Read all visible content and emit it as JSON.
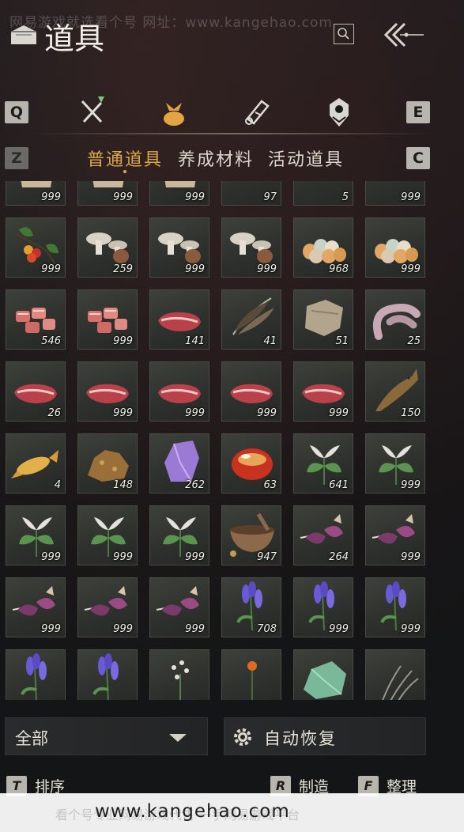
{
  "watermark_top": "网易游戏就选看个号   网址：www.kangehao.com",
  "header": {
    "title": "道具"
  },
  "category_tabs": {
    "prev_key": "Q",
    "next_key": "E",
    "tabs": [
      {
        "icon": "crossed-weapons-icon",
        "active": false
      },
      {
        "icon": "pouch-icon",
        "active": true
      },
      {
        "icon": "scroll-icon",
        "active": false
      },
      {
        "icon": "token-icon",
        "active": false
      }
    ]
  },
  "sub_tabs": {
    "prev_key": "Z",
    "next_key": "C",
    "tabs": [
      {
        "label": "普通道具",
        "active": true
      },
      {
        "label": "养成材料",
        "active": false
      },
      {
        "label": "活动道具",
        "active": false
      }
    ]
  },
  "items": [
    {
      "icon": "grain-sack-icon",
      "count": "999"
    },
    {
      "icon": "grain-sack-icon",
      "count": "999"
    },
    {
      "icon": "grain-sack-icon",
      "count": "999"
    },
    {
      "icon": "fish-icon",
      "count": "97"
    },
    {
      "icon": "berries-icon",
      "count": "5"
    },
    {
      "icon": "berries-icon",
      "count": "999"
    },
    {
      "icon": "berry-branch-icon",
      "count": "999"
    },
    {
      "icon": "mushrooms-icon",
      "count": "259"
    },
    {
      "icon": "mushrooms-icon",
      "count": "999"
    },
    {
      "icon": "mushrooms-icon",
      "count": "999"
    },
    {
      "icon": "eggs-icon",
      "count": "968"
    },
    {
      "icon": "eggs-icon",
      "count": "999"
    },
    {
      "icon": "meat-chunks-icon",
      "count": "546"
    },
    {
      "icon": "meat-chunks-icon",
      "count": "999"
    },
    {
      "icon": "steak-icon",
      "count": "141"
    },
    {
      "icon": "feathers-icon",
      "count": "41"
    },
    {
      "icon": "hide-icon",
      "count": "51"
    },
    {
      "icon": "sausage-icon",
      "count": "25"
    },
    {
      "icon": "steak-icon",
      "count": "26"
    },
    {
      "icon": "steak-icon",
      "count": "999"
    },
    {
      "icon": "steak-icon",
      "count": "999"
    },
    {
      "icon": "steak-icon",
      "count": "999"
    },
    {
      "icon": "steak-icon",
      "count": "999"
    },
    {
      "icon": "carp-icon",
      "count": "150"
    },
    {
      "icon": "golden-carp-icon",
      "count": "4"
    },
    {
      "icon": "ore-icon",
      "count": "148"
    },
    {
      "icon": "amethyst-icon",
      "count": "262"
    },
    {
      "icon": "red-stone-icon",
      "count": "63"
    },
    {
      "icon": "herb-icon",
      "count": "641"
    },
    {
      "icon": "herb-icon",
      "count": "999"
    },
    {
      "icon": "herb-icon",
      "count": "999"
    },
    {
      "icon": "herb-icon",
      "count": "999"
    },
    {
      "icon": "herb-icon",
      "count": "999"
    },
    {
      "icon": "mortar-icon",
      "count": "947"
    },
    {
      "icon": "purple-flower-icon",
      "count": "264"
    },
    {
      "icon": "purple-flower-icon",
      "count": "999"
    },
    {
      "icon": "purple-flower-icon",
      "count": "999"
    },
    {
      "icon": "purple-flower-icon",
      "count": "999"
    },
    {
      "icon": "purple-flower-icon",
      "count": "999"
    },
    {
      "icon": "lavender-icon",
      "count": "708"
    },
    {
      "icon": "lavender-icon",
      "count": "999"
    },
    {
      "icon": "lavender-icon",
      "count": "999"
    },
    {
      "icon": "lavender-icon",
      "count": ""
    },
    {
      "icon": "lavender-icon",
      "count": ""
    },
    {
      "icon": "white-flowers-icon",
      "count": ""
    },
    {
      "icon": "orange-flower-icon",
      "count": ""
    },
    {
      "icon": "jade-stone-icon",
      "count": ""
    },
    {
      "icon": "grass-icon",
      "count": ""
    }
  ],
  "footer": {
    "filter_label": "全部",
    "auto_restore_label": "自动恢复",
    "hotkeys": [
      {
        "key": "T",
        "label": "排序"
      },
      {
        "key": "R",
        "label": "制造"
      },
      {
        "key": "F",
        "label": "整理"
      }
    ]
  },
  "watermark_bottom": "www.kangehao.com",
  "watermark_bottom_ghost": "看个号专业网易游戏代售  一手网易游戏平台"
}
